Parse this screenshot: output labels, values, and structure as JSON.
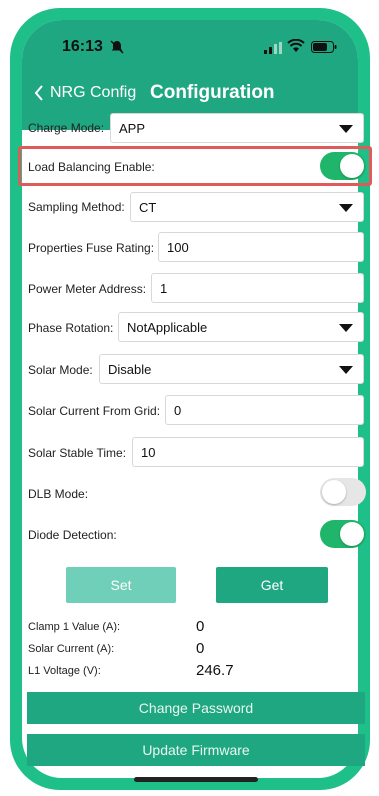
{
  "status_bar": {
    "time": "16:13"
  },
  "nav": {
    "back_label": "NRG Config",
    "title": "Configuration"
  },
  "form": {
    "charge_mode": {
      "label": "Charge Mode:",
      "value": "APP"
    },
    "load_balancing": {
      "label": "Load Balancing Enable:",
      "enabled": true
    },
    "sampling_method": {
      "label": "Sampling Method:",
      "value": "CT"
    },
    "fuse_rating": {
      "label": "Properties Fuse Rating:",
      "value": "100"
    },
    "meter_address": {
      "label": "Power Meter Address:",
      "value": "1"
    },
    "phase_rotation": {
      "label": "Phase Rotation:",
      "value": "NotApplicable"
    },
    "solar_mode": {
      "label": "Solar Mode:",
      "value": "Disable"
    },
    "solar_current_grid": {
      "label": "Solar Current From Grid:",
      "value": "0"
    },
    "solar_stable_time": {
      "label": "Solar Stable Time:",
      "value": "10"
    },
    "dlb_mode": {
      "label": "DLB Mode:",
      "enabled": false
    },
    "diode_detection": {
      "label": "Diode Detection:",
      "enabled": true
    }
  },
  "actions": {
    "set_label": "Set",
    "get_label": "Get"
  },
  "readouts": [
    {
      "label": "Clamp 1 Value (A):",
      "value": "0"
    },
    {
      "label": "Solar Current (A):",
      "value": "0"
    },
    {
      "label": "L1 Voltage (V):",
      "value": "246.7"
    }
  ],
  "buttons": {
    "change_password": "Change Password",
    "update_firmware": "Update Firmware"
  },
  "colors": {
    "accent": "#1fa781",
    "toggle_on": "#1fb66b",
    "set_disabled": "#6fcfb8",
    "highlight": "#e05a5a"
  }
}
